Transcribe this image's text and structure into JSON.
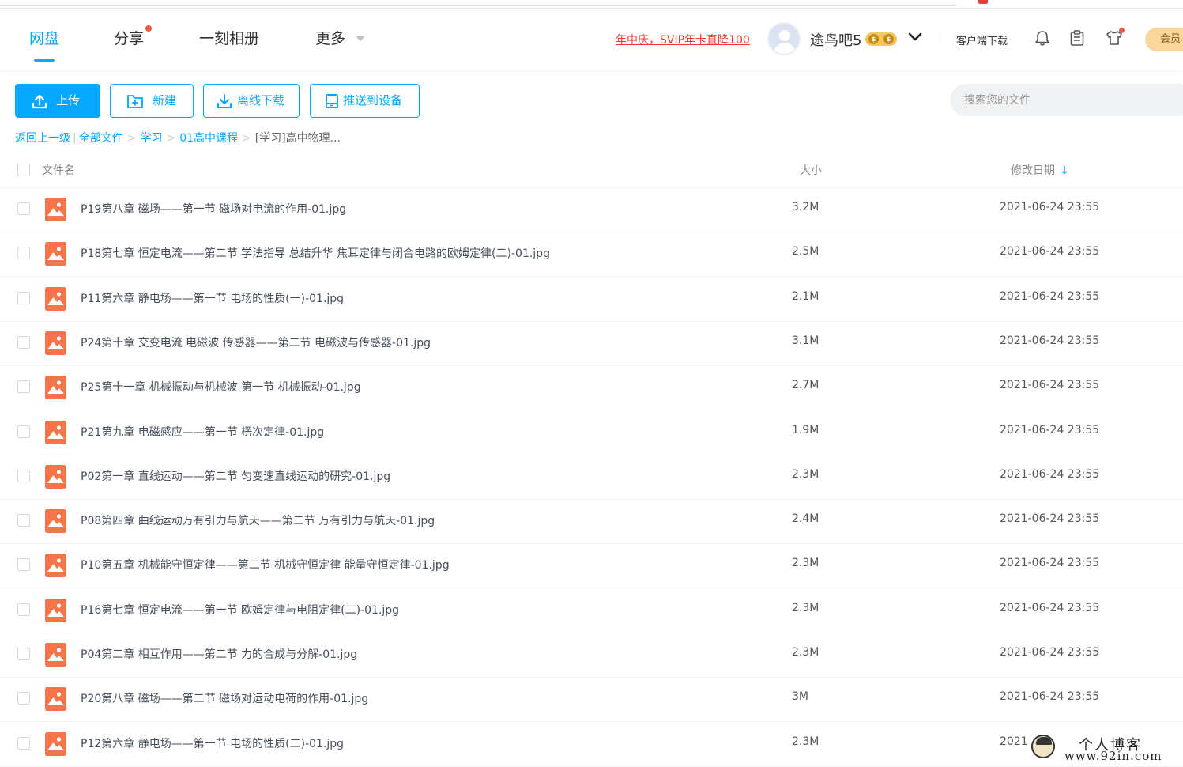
{
  "header": {
    "nav": [
      "网盘",
      "分享",
      "一刻相册",
      "更多"
    ],
    "promo": "年中庆，SVIP年卡直降100",
    "username": "途鸟吧5",
    "vip_coin": "$",
    "client_download": "客户端下载",
    "member": "会员"
  },
  "toolbar": {
    "upload": "上传",
    "new": "新建",
    "offline": "离线下载",
    "push": "推送到设备"
  },
  "search": {
    "placeholder": "搜索您的文件"
  },
  "breadcrumb": {
    "back": "返回上一级",
    "items": [
      "全部文件",
      "学习",
      "01高中课程"
    ],
    "current": "[学习]高中物理..."
  },
  "table": {
    "col_name": "文件名",
    "col_size": "大小",
    "col_date": "修改日期",
    "rows": [
      {
        "name": "P19第八章 磁场——第一节 磁场对电流的作用-01.jpg",
        "size": "3.2M",
        "date": "2021-06-24 23:55"
      },
      {
        "name": "P18第七章 恒定电流——第二节 学法指导 总结升华 焦耳定律与闭合电路的欧姆定律(二)-01.jpg",
        "size": "2.5M",
        "date": "2021-06-24 23:55"
      },
      {
        "name": "P11第六章 静电场——第一节 电场的性质(一)-01.jpg",
        "size": "2.1M",
        "date": "2021-06-24 23:55"
      },
      {
        "name": "P24第十章 交变电流 电磁波 传感器——第二节 电磁波与传感器-01.jpg",
        "size": "3.1M",
        "date": "2021-06-24 23:55"
      },
      {
        "name": "P25第十一章 机械振动与机械波 第一节 机械振动-01.jpg",
        "size": "2.7M",
        "date": "2021-06-24 23:55"
      },
      {
        "name": "P21第九章 电磁感应——第一节 楞次定律-01.jpg",
        "size": "1.9M",
        "date": "2021-06-24 23:55"
      },
      {
        "name": "P02第一章 直线运动——第二节 匀变速直线运动的研究-01.jpg",
        "size": "2.3M",
        "date": "2021-06-24 23:55"
      },
      {
        "name": "P08第四章 曲线运动万有引力与航天——第二节 万有引力与航天-01.jpg",
        "size": "2.4M",
        "date": "2021-06-24 23:55"
      },
      {
        "name": "P10第五章 机械能守恒定律——第二节 机械守恒定律 能量守恒定律-01.jpg",
        "size": "2.3M",
        "date": "2021-06-24 23:55"
      },
      {
        "name": "P16第七章 恒定电流——第一节 欧姆定律与电阻定律(二)-01.jpg",
        "size": "2.3M",
        "date": "2021-06-24 23:55"
      },
      {
        "name": "P04第二章 相互作用——第二节 力的合成与分解-01.jpg",
        "size": "2.3M",
        "date": "2021-06-24 23:55"
      },
      {
        "name": "P20第八章 磁场——第二节 磁场对运动电荷的作用-01.jpg",
        "size": "3M",
        "date": "2021-06-24 23:55"
      },
      {
        "name": "P12第六章 静电场——第一节 电场的性质(二)-01.jpg",
        "size": "2.3M",
        "date": "2021"
      }
    ]
  },
  "watermark": {
    "line1": "个人博客",
    "line2": "www.92in.com"
  },
  "colors": {
    "accent": "#06a7ff",
    "file_icon": "#f5744a",
    "promo": "#f23b2a"
  }
}
